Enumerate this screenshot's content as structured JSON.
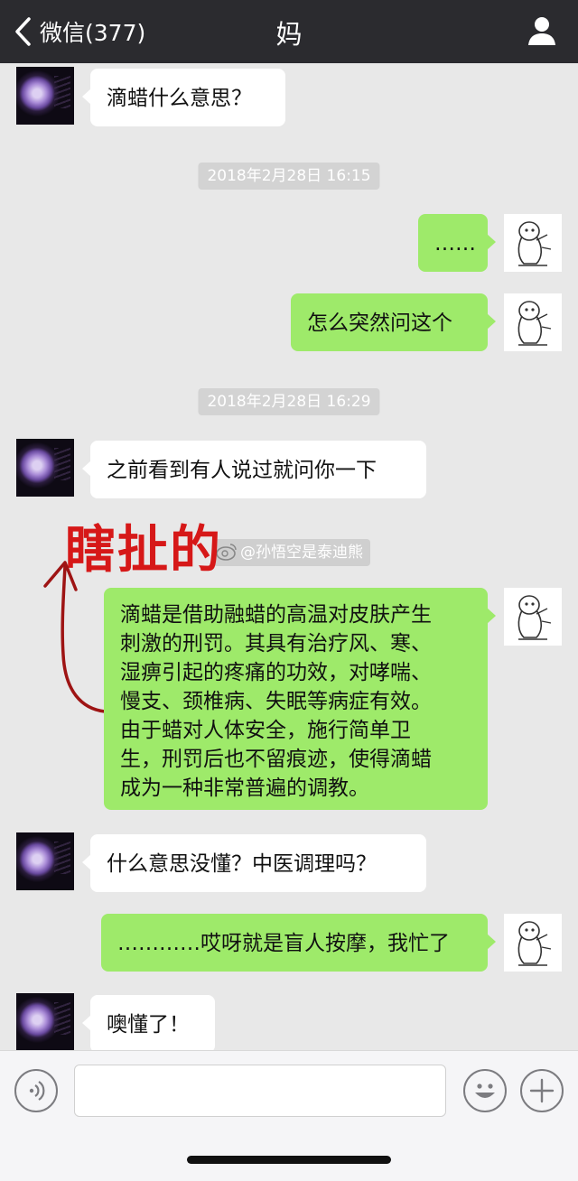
{
  "header": {
    "back_label": "微信(377)",
    "title": "妈"
  },
  "messages": [
    {
      "from": "contact",
      "text": "滴蜡什么意思？"
    },
    {
      "timestamp": "2018年2月28日 16:15"
    },
    {
      "from": "me",
      "text": "……"
    },
    {
      "from": "me",
      "text": "怎么突然问这个"
    },
    {
      "timestamp": "2018年2月28日 16:29"
    },
    {
      "from": "contact",
      "text": "之前看到有人说过就问你一下"
    },
    {
      "from": "me",
      "lines": [
        "滴蜡是借助融蜡的高温对皮肤产生",
        "刺激的刑罚。其具有治疗风、寒、",
        "湿痹引起的疼痛的功效，对哮喘、",
        "慢支、颈椎病、失眠等病症有效。",
        "由于蜡对人体安全，施行简单卫",
        "生，刑罚后也不留痕迹，使得滴蜡",
        "成为一种非常普遍的调教。"
      ]
    },
    {
      "from": "contact",
      "text": "什么意思没懂？中医调理吗？"
    },
    {
      "from": "me",
      "text": "…………哎呀就是盲人按摩，我忙了"
    },
    {
      "from": "contact",
      "text": "噢懂了！"
    }
  ],
  "annotation": {
    "text": "瞎扯的",
    "color": "#d61818"
  },
  "watermark": {
    "text": "@孙悟空是泰迪熊"
  },
  "colors": {
    "topbar": "#2b2b2f",
    "chat_bg": "#e8e8e8",
    "outgoing_bubble": "#9eea6a",
    "incoming_bubble": "#ffffff"
  },
  "icons": {
    "back": "chevron-left-icon",
    "profile": "person-icon",
    "voice": "voice-icon",
    "emoji": "emoji-icon",
    "more": "plus-icon"
  }
}
